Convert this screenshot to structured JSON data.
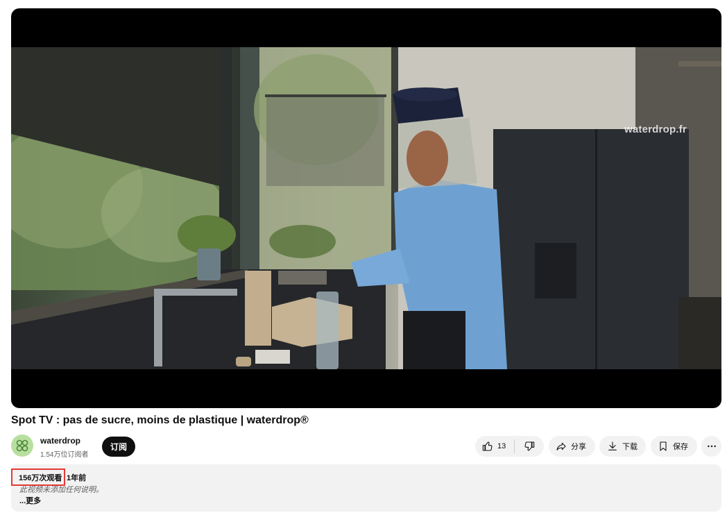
{
  "video": {
    "watermark": "waterdrop.fr",
    "title": "Spot TV : pas de sucre, moins de plastique | waterdrop®"
  },
  "channel": {
    "name": "waterdrop",
    "subscribers": "1.54万位订阅者",
    "subscribe_label": "订阅"
  },
  "actions": {
    "like_count": "13",
    "share_label": "分享",
    "download_label": "下载",
    "save_label": "保存"
  },
  "description": {
    "views": "156万次观看",
    "date": "1年前",
    "empty_text": "此视频未添加任何说明。",
    "more_label": "...更多"
  },
  "icons": [
    "thumbs-up-icon",
    "thumbs-down-icon",
    "share-icon",
    "download-icon",
    "bookmark-icon",
    "more-icon",
    "channel-logo-icon"
  ],
  "colors": {
    "subscribe_bg": "#0f0f0f",
    "pill_bg": "#f2f2f2",
    "highlight_border": "#e53935",
    "avatar_bg": "#b9dfa0"
  }
}
